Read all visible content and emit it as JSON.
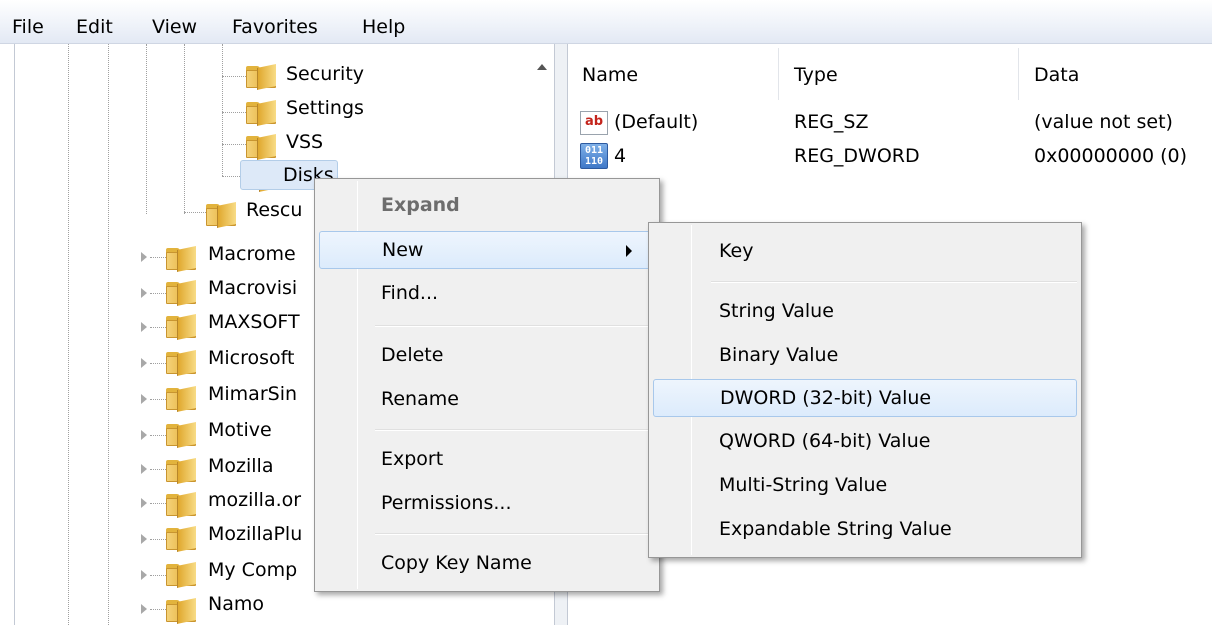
{
  "menubar": {
    "file": "File",
    "edit": "Edit",
    "view": "View",
    "favorites": "Favorites",
    "help": "Help"
  },
  "tree": {
    "items": [
      {
        "label": "Security"
      },
      {
        "label": "Settings"
      },
      {
        "label": "VSS"
      },
      {
        "label": "Disks"
      },
      {
        "label": "Rescu"
      },
      {
        "label": "Macrome"
      },
      {
        "label": "Macrovisi"
      },
      {
        "label": "MAXSOFT"
      },
      {
        "label": "Microsoft"
      },
      {
        "label": "MimarSin"
      },
      {
        "label": "Motive"
      },
      {
        "label": "Mozilla"
      },
      {
        "label": "mozilla.or"
      },
      {
        "label": "MozillaPlu"
      },
      {
        "label": "My Comp"
      },
      {
        "label": "Namo"
      }
    ]
  },
  "values": {
    "headers": {
      "name": "Name",
      "type": "Type",
      "data": "Data"
    },
    "rows": [
      {
        "name": "(Default)",
        "type": "REG_SZ",
        "data": "(value not set)",
        "icon": "string-value-icon",
        "icon_text": "ab"
      },
      {
        "name": "4",
        "type": "REG_DWORD",
        "data": "0x00000000 (0)",
        "icon": "binary-value-icon",
        "icon_text": "011 110"
      }
    ]
  },
  "context_menu": {
    "items": [
      {
        "label": "Expand"
      },
      {
        "label": "New"
      },
      {
        "label": "Find..."
      },
      {
        "label": "Delete"
      },
      {
        "label": "Rename"
      },
      {
        "label": "Export"
      },
      {
        "label": "Permissions..."
      },
      {
        "label": "Copy Key Name"
      }
    ]
  },
  "submenu": {
    "items": [
      {
        "label": "Key"
      },
      {
        "label": "String Value"
      },
      {
        "label": "Binary Value"
      },
      {
        "label": "DWORD (32-bit) Value"
      },
      {
        "label": "QWORD (64-bit) Value"
      },
      {
        "label": "Multi-String Value"
      },
      {
        "label": "Expandable String Value"
      }
    ]
  }
}
